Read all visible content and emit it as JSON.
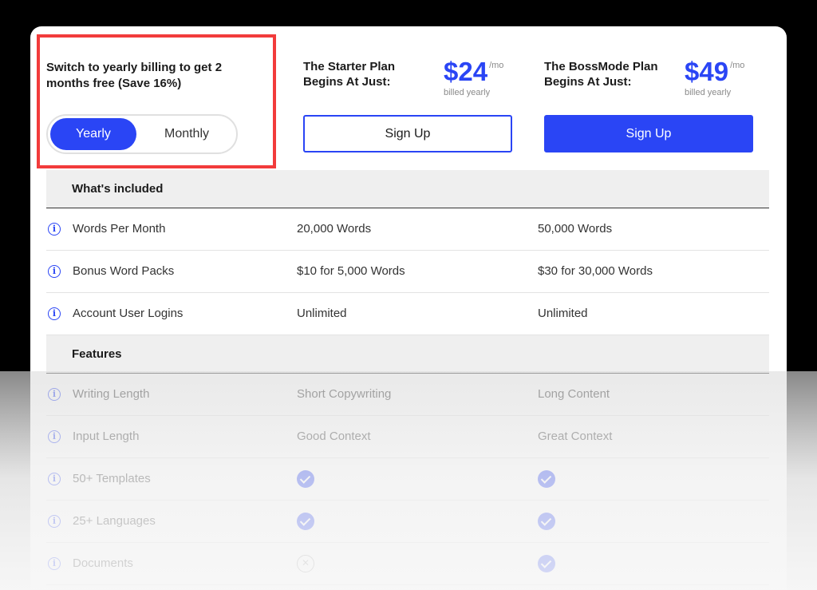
{
  "billing": {
    "promo_text": "Switch to yearly billing to get 2 months free (Save 16%)",
    "toggle": {
      "yearly": "Yearly",
      "monthly": "Monthly",
      "selected": "Yearly"
    }
  },
  "plans": [
    {
      "name": "The Starter Plan Begins At Just:",
      "price": "$24",
      "per": "/mo",
      "billed": "billed yearly",
      "cta": "Sign Up",
      "style": "outline"
    },
    {
      "name": "The BossMode Plan Begins At Just:",
      "price": "$49",
      "per": "/mo",
      "billed": "billed yearly",
      "cta": "Sign Up",
      "style": "filled"
    }
  ],
  "sections": {
    "included_title": "What's included",
    "features_title": "Features"
  },
  "included_rows": [
    {
      "label": "Words Per Month",
      "starter": "20,000 Words",
      "boss": "50,000 Words"
    },
    {
      "label": "Bonus Word Packs",
      "starter": "$10 for 5,000 Words",
      "boss": "$30 for 30,000 Words"
    },
    {
      "label": "Account User Logins",
      "starter": "Unlimited",
      "boss": "Unlimited"
    }
  ],
  "feature_rows": [
    {
      "label": "Writing Length",
      "starter": "Short Copywriting",
      "boss": "Long Content"
    },
    {
      "label": "Input Length",
      "starter": "Good Context",
      "boss": "Great Context"
    },
    {
      "label": "50+ Templates",
      "starter_icon": "check-icon",
      "boss_icon": "check-icon"
    },
    {
      "label": "25+ Languages",
      "starter_icon": "check-icon",
      "boss_icon": "check-icon"
    },
    {
      "label": "Documents",
      "starter_icon": "x-icon",
      "boss_icon": "check-icon"
    }
  ],
  "colors": {
    "accent": "#2a45f5",
    "highlight": "#f23b3b"
  }
}
